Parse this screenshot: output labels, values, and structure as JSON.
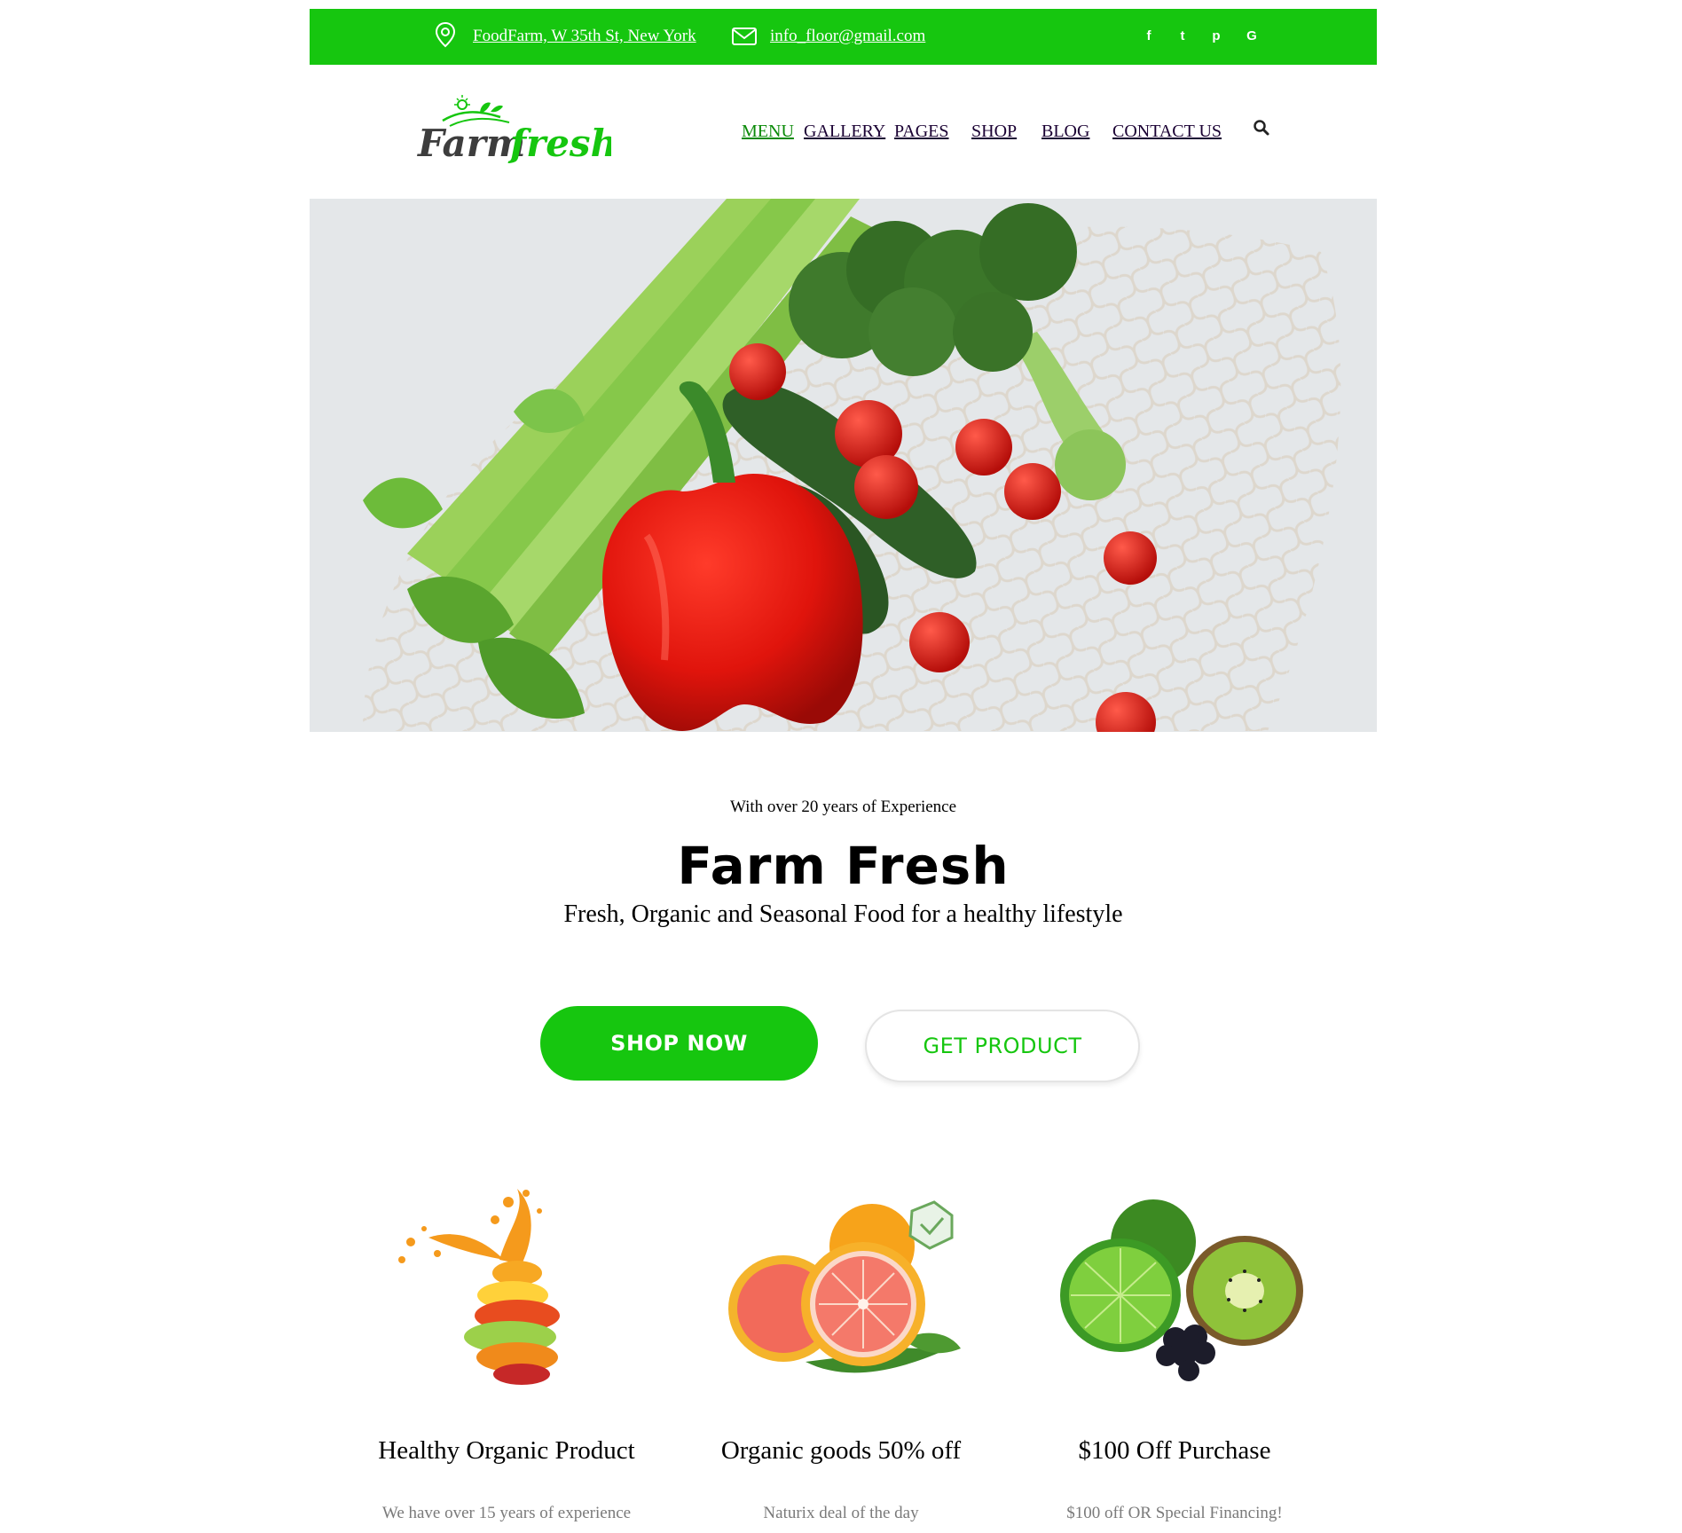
{
  "topbar": {
    "location": "FoodFarm, W 35th St, New York",
    "email": "info_floor@gmail.com",
    "social": [
      {
        "name": "facebook-icon",
        "glyph": "f"
      },
      {
        "name": "twitter-icon",
        "glyph": "t"
      },
      {
        "name": "pinterest-icon",
        "glyph": "p"
      },
      {
        "name": "google-icon",
        "glyph": "G"
      }
    ]
  },
  "logo": {
    "part1": "Farm",
    "part2": "fresh"
  },
  "nav": [
    {
      "label": "MENU",
      "active": true
    },
    {
      "label": "GALLERY",
      "active": false
    },
    {
      "label": "PAGES",
      "active": false
    },
    {
      "label": "SHOP",
      "active": false
    },
    {
      "label": "BLOG",
      "active": false
    },
    {
      "label": "CONTACT US",
      "active": false
    }
  ],
  "intro": {
    "eyebrow": "With over 20 years of Experience",
    "title": "Farm Fresh",
    "subtitle": "Fresh, Organic and Seasonal Food for a healthy lifestyle"
  },
  "buttons": {
    "shop": "SHOP NOW",
    "get": "GET PRODUCT"
  },
  "features": [
    {
      "title": "Healthy Organic Product",
      "desc": "We have over 15 years of experience"
    },
    {
      "title": "Organic goods 50% off",
      "desc": "Naturix deal of the day"
    },
    {
      "title": "$100 Off Purchase",
      "desc": "$100 off OR Special Financing!"
    }
  ],
  "colors": {
    "brand": "#16c60f",
    "text": "#000000",
    "muted": "#7a7a7a"
  }
}
